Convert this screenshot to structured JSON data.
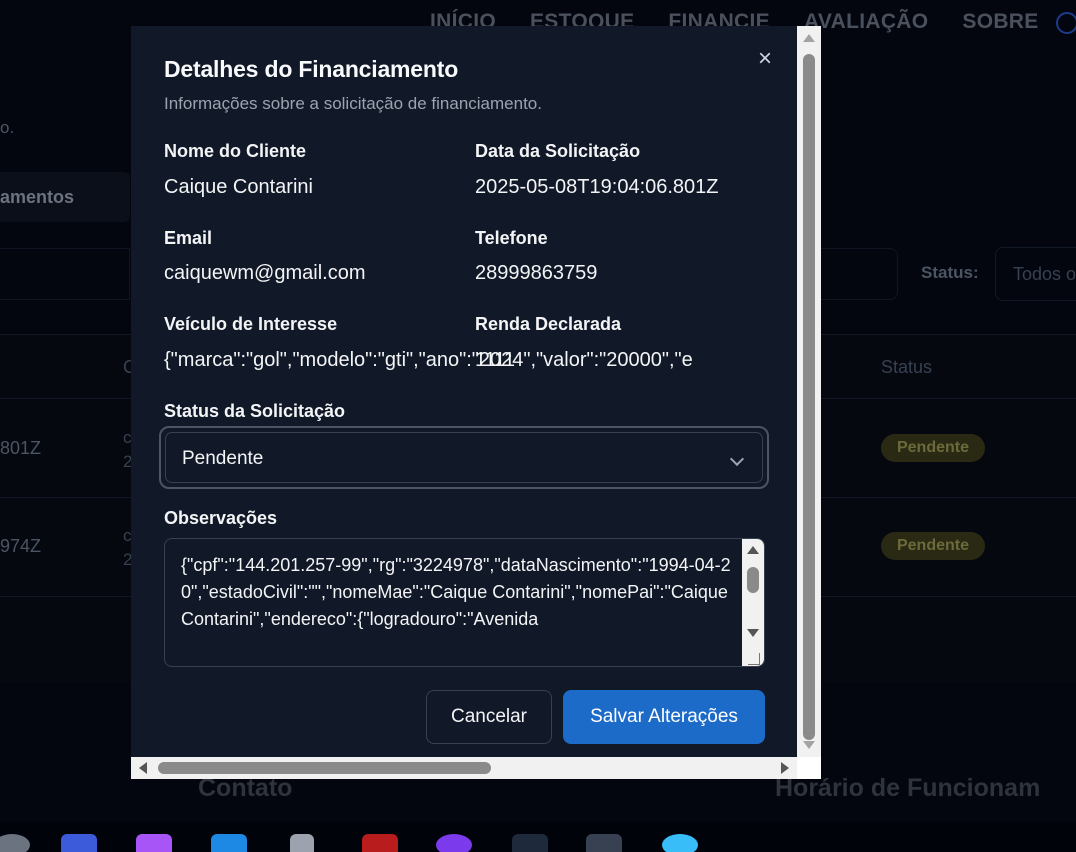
{
  "background": {
    "nav": [
      "INÍCIO",
      "ESTOQUE",
      "FINANCIE",
      "AVALIAÇÃO",
      "SOBRE"
    ],
    "subtitle_fragment": "o.",
    "tab_fragment": "amentos",
    "status_label": "Status:",
    "status_select_fragment": "Todos o",
    "table": {
      "header_c": "C",
      "header_status": "Status",
      "rows": [
        {
          "date_fragment": "801Z",
          "c_fragment_a": "c",
          "c_fragment_b": "2",
          "status": "Pendente"
        },
        {
          "date_fragment": "974Z",
          "c_fragment_a": "c",
          "c_fragment_b": "2",
          "status": "Pendente"
        }
      ]
    },
    "footer": {
      "contato": "Contato",
      "horario": "Horário de Funcionam"
    }
  },
  "modal": {
    "title": "Detalhes do Financiamento",
    "subtitle": "Informações sobre a solicitação de financiamento.",
    "close_symbol": "×",
    "fields": {
      "client_name": {
        "label": "Nome do Cliente",
        "value": "Caique Contarini"
      },
      "request_date": {
        "label": "Data da Solicitação",
        "value": "2025-05-08T19:04:06.801Z"
      },
      "email": {
        "label": "Email",
        "value": "caiquewm@gmail.com"
      },
      "phone": {
        "label": "Telefone",
        "value": "28999863759"
      },
      "vehicle": {
        "label": "Veículo de Interesse",
        "value": "{\"marca\":\"gol\",\"modelo\":\"gti\",\"ano\":\"2024\",\"valor\":\"20000\",\"e"
      },
      "income": {
        "label": "Renda Declarada",
        "value": "1111"
      }
    },
    "status": {
      "label": "Status da Solicitação",
      "selected": "Pendente"
    },
    "notes": {
      "label": "Observações",
      "value": "{\"cpf\":\"144.201.257-99\",\"rg\":\"3224978\",\"dataNascimento\":\"1994-04-20\",\"estadoCivil\":\"\",\"nomeMae\":\"Caique Contarini\",\"nomePai\":\"Caique Contarini\",\"endereco\":{\"logradouro\":\"Avenida"
    },
    "buttons": {
      "cancel": "Cancelar",
      "save": "Salvar Alterações"
    }
  },
  "colors": {
    "modal_bg": "#111827",
    "primary": "#1d6bc9",
    "badge_pending_bg": "#2a2913",
    "badge_pending_text": "#6b6a3b"
  },
  "taskbar": {
    "icons": [
      "app-icon",
      "vscode-insiders-icon",
      "app-purple-icon",
      "vscode-icon",
      "app-icon",
      "app-icon",
      "github-icon",
      "app-icon",
      "app-icon",
      "app-icon"
    ]
  }
}
